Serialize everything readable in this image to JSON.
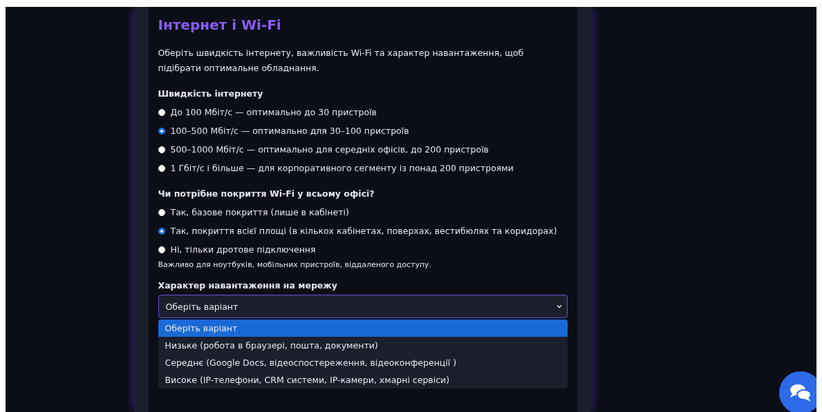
{
  "title": "Інтернет і Wi-Fi",
  "intro": "Оберіть швидкість інтернету, важливість Wi-Fi та характер навантаження, щоб підібрати оптимальне обладнання.",
  "groups": [
    {
      "label": "Швидкість інтернету",
      "options": [
        {
          "label": "До 100 Мбіт/с — оптимально до 30 пристроїв",
          "selected": false
        },
        {
          "label": "100–500 Мбіт/с — оптимально для 30–100 пристроїв",
          "selected": true
        },
        {
          "label": "500–1000 Мбіт/с — оптимально для середніх офісів, до 200 пристроїв",
          "selected": false
        },
        {
          "label": "1 Гбіт/с і більше — для корпоративного сегменту із понад 200 пристроями",
          "selected": false
        }
      ]
    },
    {
      "label": "Чи потрібне покриття Wi-Fi у всьому офісі?",
      "options": [
        {
          "label": "Так, базове покриття (лише в кабінеті)",
          "selected": false
        },
        {
          "label": "Так, покриття всієї площі (в кількох кабінетах, поверхах, вестибюлях та коридорах)",
          "selected": true
        },
        {
          "label": "Ні, тільки дротове підключення",
          "selected": false
        }
      ],
      "hint": "Важливо для ноутбуків, мобільних пристроїв, віддаленого доступу."
    }
  ],
  "load": {
    "label": "Характер навантаження на мережу",
    "value": "Оберіть варіант",
    "expanded": true,
    "options": [
      {
        "label": "Оберіть варіант",
        "selected": true
      },
      {
        "label": "Низьке (робота в браузері, пошта, документи)",
        "selected": false
      },
      {
        "label": "Середнє (Google Docs, відеоспостереження, відеоконференції )",
        "selected": false
      },
      {
        "label": "Високе (IP-телефони, CRM системи, IP-камери, хмарні сервіси)",
        "selected": false
      }
    ]
  }
}
